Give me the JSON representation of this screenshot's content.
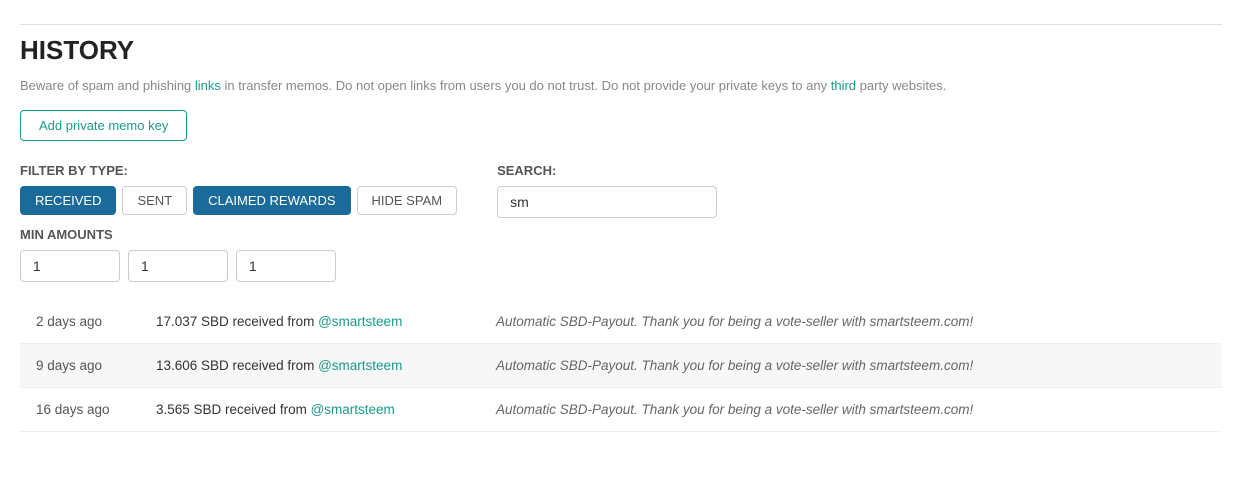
{
  "page": {
    "title": "HISTORY",
    "warning": "Beware of spam and phishing links in transfer memos. Do not open links from users you do not trust. Do not provide your private keys to any third party websites.",
    "warning_link1": "links",
    "warning_link2": "third",
    "memo_btn": "Add private memo key"
  },
  "filters": {
    "label": "FILTER BY TYPE:",
    "buttons": [
      {
        "label": "RECEIVED",
        "active": true
      },
      {
        "label": "SENT",
        "active": false
      },
      {
        "label": "CLAIMED REWARDS",
        "active": true
      },
      {
        "label": "HIDE SPAM",
        "active": false
      }
    ]
  },
  "search": {
    "label": "SEARCH:",
    "value": "sm",
    "placeholder": ""
  },
  "min_amounts": {
    "label": "MIN AMOUNTS",
    "values": [
      "1",
      "1",
      "1"
    ]
  },
  "rows": [
    {
      "date": "2 days ago",
      "amount": "17.037 SBD received from ",
      "user": "@smartsteem",
      "memo": "Automatic SBD-Payout. Thank you for being a vote-seller with smartsteem.com!"
    },
    {
      "date": "9 days ago",
      "amount": "13.606 SBD received from ",
      "user": "@smartsteem",
      "memo": "Automatic SBD-Payout. Thank you for being a vote-seller with smartsteem.com!"
    },
    {
      "date": "16 days ago",
      "amount": "3.565 SBD received from ",
      "user": "@smartsteem",
      "memo": "Automatic SBD-Payout. Thank you for being a vote-seller with smartsteem.com!"
    }
  ]
}
